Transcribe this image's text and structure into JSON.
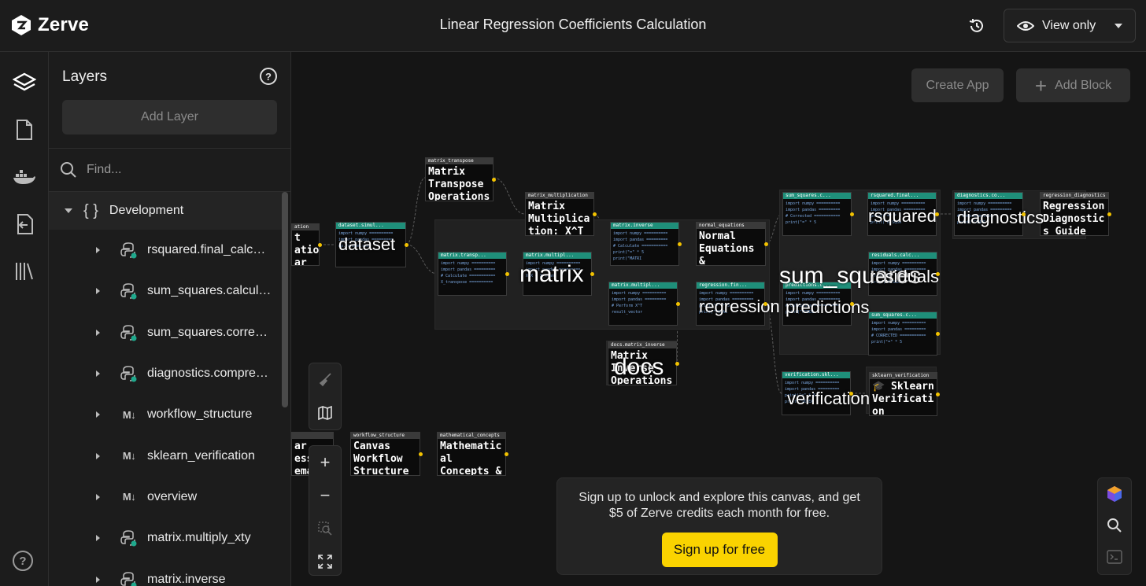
{
  "app": {
    "brand": "Zerve",
    "title": "Linear Regression Coefficients Calculation"
  },
  "header": {
    "view_label": "View only"
  },
  "rail": {
    "items": [
      "layers-icon",
      "document-icon",
      "docker-icon",
      "file-export-icon",
      "library-icon"
    ]
  },
  "layers": {
    "title": "Layers",
    "add_label": "Add Layer",
    "find_placeholder": "Find...",
    "group": "Development",
    "items": [
      {
        "label": "rsquared.final_calculation",
        "type": "python"
      },
      {
        "label": "sum_squares.calculation",
        "type": "python"
      },
      {
        "label": "sum_squares.corrected",
        "type": "python"
      },
      {
        "label": "diagnostics.comprehensive",
        "type": "python"
      },
      {
        "label": "workflow_structure",
        "type": "markdown"
      },
      {
        "label": "sklearn_verification",
        "type": "markdown"
      },
      {
        "label": "overview",
        "type": "markdown"
      },
      {
        "label": "matrix.multiply_xty",
        "type": "python"
      },
      {
        "label": "matrix.inverse",
        "type": "python"
      }
    ]
  },
  "canvas": {
    "create_app": "Create App",
    "add_block": "Add Block",
    "groups": [
      "dataset",
      "matrix",
      "docs",
      "sum_squares",
      "rsquared",
      "diagnostics",
      "regression",
      "predictions",
      "verification",
      "residuals"
    ],
    "blocks": {
      "matrix_transpose": {
        "header": "matrix_transpose",
        "body": "Matrix\nTranspose\nOperations"
      },
      "matrix_multiplication": {
        "header": "matrix_multiplication",
        "body": "Matrix\nMultiplica\ntion: X^T"
      },
      "normal_equations": {
        "header": "normal_equations",
        "body": "Normal\nEquations\n&"
      },
      "regression_diagnostics": {
        "header": "regression_diagnostics",
        "body": "Regression\nDiagnostic\ns Guide"
      },
      "docs_matrix_inverse": {
        "header": "docs.matrix_inverse",
        "body": "Matrix\nInverse\nOperations"
      },
      "sklearn_verification": {
        "header": "sklearn_verification",
        "body": "🎓 Sklearn\nVerificati\non"
      },
      "workflow_structure": {
        "header": "workflow_structure",
        "body": "Canvas\nWorkflow\nStructure"
      },
      "mathematical_concepts": {
        "header": "mathematical_concepts",
        "body": "Mathematic\nal\nConcepts &"
      },
      "overview_partial": {
        "header": "ation",
        "body": "t\nation\nar"
      },
      "left_partial": {
        "header": "",
        "body": "ar\ness\nema"
      },
      "dataset_simul": {
        "header": "dataset.simul...",
        "code": "import numpy ==========\nimport pandas =========\nnp.random.see"
      },
      "matrix_transp": {
        "header": "matrix.transp...",
        "code": "import numpy ==========\nimport pandas =========\n# Calculate ===========\nX_transpose =========="
      },
      "matrix_multipl_1": {
        "header": "matrix.multipl...",
        "code": "import numpy ==========\nimport pandas =========\nXtX = X_trans"
      },
      "matrix_inverse": {
        "header": "matrix.inverse",
        "code": "import numpy ==========\nimport pandas =========\n# Calculate ===========\nprint(\"=\" * 5\nprint(\"MATRI"
      },
      "matrix_multipl_2": {
        "header": "matrix.multipl...",
        "code": "import numpy ==========\nimport pandas =========\n# Perform X^T\nresult_vector"
      },
      "regression_fin": {
        "header": "regression.fin...",
        "code": "import numpy ==========\nimport pandas =========\nprint(\"=\" * 5\nprint(\"FINAL"
      },
      "sum_squares_c1": {
        "header": "sum_squares.c...",
        "code": "import numpy ==========\nimport pandas =========\n# Corrected ===========\nprint(\"=\" * 5"
      },
      "rsquared_final": {
        "header": "rsquared.final...",
        "code": "import numpy ==========\nimport pandas =========\nprint(\"=\" * 5\nprint(\"R-SQUA"
      },
      "diagnostics_co": {
        "header": "diagnostics.co...",
        "code": "import numpy ==========\nimport pandas =========\n# Comprehensive\nprint(\"COMPR"
      },
      "residuals_calc": {
        "header": "residuals.calc...",
        "code": "import numpy ==========\nimport pandas =========\nprint(\"=\" * 5\nprint(\"RESID"
      },
      "predictions_c": {
        "header": "predictions.c...",
        "code": "import numpy ==========\nimport pandas =========\n# Calculate ===========\nprint(\"PREDI"
      },
      "sum_squares_c2": {
        "header": "sum_squares.c...",
        "code": "import numpy ==========\nimport pandas =========\n# CORRECTED ===========\nprint(\"=\" * 5"
      },
      "verification_skl": {
        "header": "verification.skl...",
        "code": "import numpy ==========\nimport pandas =========\nprint(\"=\" * 5\nprint(\"SKLEA"
      }
    }
  },
  "cta": {
    "message": "Sign up to unlock and explore this canvas, and get $5 of Zerve credits each month for free.",
    "button": "Sign up for free"
  },
  "colors": {
    "accent": "#fad300",
    "code_header": "#1f8f7a",
    "edge_dot": "#f2c200"
  }
}
